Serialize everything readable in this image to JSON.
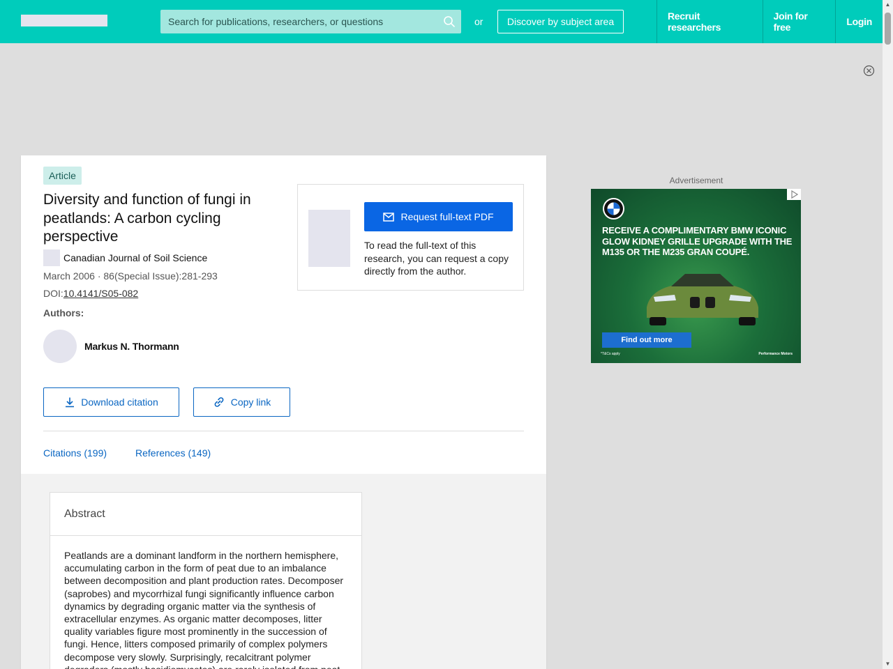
{
  "header": {
    "search_placeholder": "Search for publications, researchers, or questions",
    "or_text": "or",
    "discover_label": "Discover by subject area",
    "nav": [
      {
        "label": "Recruit researchers"
      },
      {
        "label": "Join for free"
      },
      {
        "label": "Login"
      }
    ]
  },
  "article": {
    "badge": "Article",
    "title": "Diversity and function of fungi in peatlands: A carbon cycling perspective",
    "journal": "Canadian Journal of Soil Science",
    "meta": "March 2006 · 86(Special Issue):281-293",
    "doi_prefix": "DOI:",
    "doi": "10.4141/S05-082",
    "authors_label": "Authors:",
    "author": "Markus N. Thormann",
    "download_citation": "Download citation",
    "copy_link": "Copy link",
    "tabs": [
      {
        "label": "Citations (199)"
      },
      {
        "label": "References (149)"
      }
    ]
  },
  "request": {
    "button": "Request full-text PDF",
    "text": "To read the full-text of this research, you can request a copy directly from the author."
  },
  "abstract": {
    "heading": "Abstract",
    "body": "Peatlands are a dominant landform in the northern hemisphere, accumulating carbon in the form of peat due to an imbalance between decomposition and plant production rates. Decomposer (saprobes) and mycorrhizal fungi significantly influence carbon dynamics by degrading organic matter via the synthesis of extracellular enzymes. As organic matter decomposes, litter quality variables figure most prominently in the succession of fungi. Hence, litters composed primarily of complex polymers decompose very slowly. Surprisingly, recalcitrant polymer degraders (mostly basidiomycetes) are rarely isolated from peat."
  },
  "ad": {
    "label": "Advertisement",
    "headline": "Receive a complimentary BMW Iconic Glow Kidney Grille upgrade with the M135 or the M235 Gran Coupé.",
    "cta": "Find out more",
    "fine_print": "*T&Cs apply",
    "dealer": "Performance Motors"
  },
  "colors": {
    "brand": "#00ccbb",
    "link": "#0a66c2",
    "primary_button": "#0a66e4"
  }
}
